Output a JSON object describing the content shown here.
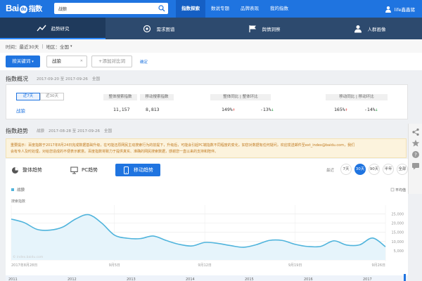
{
  "header": {
    "logo_text": "Bai",
    "logo_paw": "du",
    "logo_zh": "指数",
    "search_value": "战狼",
    "nav": [
      {
        "label": "指数探索",
        "active": true
      },
      {
        "label": "数说专题",
        "active": false
      },
      {
        "label": "品牌表现",
        "active": false
      },
      {
        "label": "我的指数",
        "active": false
      }
    ],
    "user_name": "life鑫鑫猪"
  },
  "subnav": [
    {
      "label": "趋势研究",
      "icon": "trend-chart-icon",
      "active": true
    },
    {
      "label": "需求图谱",
      "icon": "demand-graph-icon",
      "active": false
    },
    {
      "label": "舆情洞察",
      "icon": "sentiment-flag-icon",
      "active": false
    },
    {
      "label": "人群画像",
      "icon": "user-profile-icon",
      "active": false
    }
  ],
  "filters": {
    "time_label": "时间：最近30天",
    "separator": "|",
    "region_label": "地区：全国",
    "dropdown_caret": "▾"
  },
  "keywords": {
    "button_label": "按关键词",
    "button_caret": "▾",
    "chip_value": "战狼",
    "chip_close": "✕",
    "add_compare_label": "+添加对比词",
    "confirm_label": "确定"
  },
  "overview": {
    "title": "指数概况",
    "date_range": "2017-09-20 至 2017-09-26",
    "region": "全国",
    "tabs": [
      {
        "label": "近7天",
        "active": true
      },
      {
        "label": "近30天",
        "active": false
      }
    ],
    "headers": {
      "overall_index": "整体搜索指数",
      "mobile_index": "移动搜索指数",
      "overall_yoy": "整体同比",
      "overall_mom": "整体环比",
      "mobile_yoy": "移动同比",
      "mobile_mom": "移动环比"
    },
    "row": {
      "keyword": "战狼",
      "overall_index": "11,157",
      "mobile_index": "8,813",
      "overall_yoy": "149%",
      "overall_yoy_arrow": "↑",
      "overall_mom": "-13%",
      "overall_mom_arrow": "↓",
      "mobile_yoy": "165%",
      "mobile_yoy_arrow": "↑",
      "mobile_mom": "-14%",
      "mobile_mom_arrow": "↓"
    }
  },
  "trend": {
    "title": "指数趋势",
    "keyword": "战狼",
    "date_range": "2017-08-28 至 2017-09-26",
    "region": "全国",
    "notice_line1": "重要提示：百度指数于2017年8月24日完成数据基础升级，在可能还原网民主动搜索行为的前提下，升级后，可能会引起PC端指数不同程度的变化，如您对数据有任何疑问，欢迎发送邮件至ext_index@baidu.com，我们",
    "notice_line2": "会有专人及时处理，对给您造成的不便表示歉意。百度指数将致力于提供真实、准确的网民搜索数据，感谢您一直以来的支持和陪伴。",
    "tabs": [
      {
        "label": "整体趋势",
        "icon": "pie-chart-icon",
        "active": false
      },
      {
        "label": "PC趋势",
        "icon": "monitor-icon",
        "active": false
      },
      {
        "label": "移动趋势",
        "icon": "mobile-phone-icon",
        "active": true
      }
    ],
    "range_label": "最近",
    "ranges": [
      {
        "label": "7天",
        "active": false
      },
      {
        "label": "30天",
        "active": true
      },
      {
        "label": "90天",
        "active": false
      },
      {
        "label": "半年",
        "active": false
      },
      {
        "label": "全部",
        "active": false
      }
    ]
  },
  "chart_data": {
    "type": "area",
    "legend": [
      "战狼"
    ],
    "ylabel": "搜索指数",
    "average_label": "平均值",
    "watermark": "© index.baidu.com",
    "ylim": [
      0,
      27500
    ],
    "yticks": [
      0,
      5000,
      10000,
      15000,
      20000,
      25000
    ],
    "ytick_labels": [
      "",
      "5,000",
      "10,000",
      "15,000",
      "20,000",
      "25,000"
    ],
    "x_labels": [
      {
        "index": 0,
        "label": "2017年8月28日"
      },
      {
        "index": 8,
        "label": "9月5日"
      },
      {
        "index": 15,
        "label": "9月12日"
      },
      {
        "index": 22,
        "label": "9月19日"
      },
      {
        "index": 29,
        "label": "9月26日"
      }
    ],
    "series": [
      {
        "name": "战狼",
        "color": "#50b4dc",
        "values": [
          22200,
          20300,
          16600,
          16200,
          17900,
          22300,
          24600,
          20100,
          13500,
          11800,
          11600,
          13000,
          10600,
          8500,
          7600,
          9500,
          9000,
          7800,
          6900,
          8300,
          10600,
          10600,
          8500,
          7300,
          7400,
          10400,
          8100,
          8200,
          11900,
          7200
        ]
      }
    ],
    "timeline_years": [
      "2011",
      "2012",
      "2013",
      "2014",
      "2015",
      "2016",
      "2017"
    ]
  },
  "colors": {
    "brand_blue": "#1f74e0",
    "subnav_bg": "#2d4a6e",
    "line": "#50b4dc",
    "up": "#e23b3b",
    "down": "#25a244"
  }
}
